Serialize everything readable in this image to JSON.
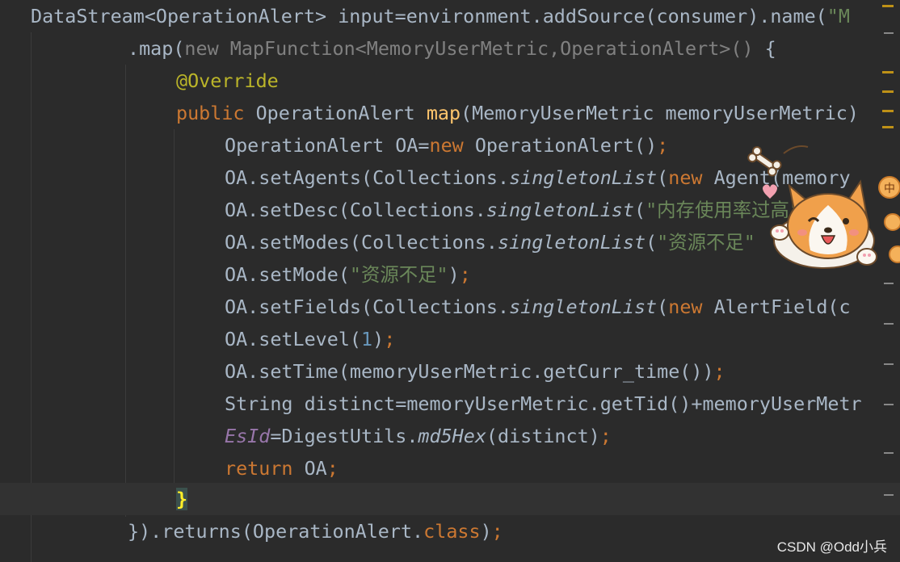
{
  "code": {
    "l1": {
      "a": "DataStream<OperationAlert> input=environment.addSource(consumer).name(",
      "b": "\"M"
    },
    "l2": {
      "a": ".map(",
      "b": "new ",
      "c": "MapFunction<MemoryUserMetric,OperationAlert>() ",
      "d": "{"
    },
    "l3": {
      "a": "@Override"
    },
    "l4": {
      "a": "public ",
      "b": "OperationAlert ",
      "c": "map",
      "d": "(MemoryUserMetric memoryUserMetric)"
    },
    "l5": {
      "a": "OperationAlert OA=",
      "b": "new ",
      "c": "OperationAlert()",
      "d": ";"
    },
    "l6": {
      "a": "OA.setAgents(Collections.",
      "b": "singletonList",
      "c": "(",
      "d": "new ",
      "e": "Agent(memory"
    },
    "l7": {
      "a": "OA.setDesc(Collections.",
      "b": "singletonList",
      "c": "(",
      "d": "\"内存使用率过高\"",
      "e": ")",
      "f": ";"
    },
    "l8": {
      "a": "OA.setModes(Collections.",
      "b": "singletonList",
      "c": "(",
      "d": "\"资源不足\""
    },
    "l9": {
      "a": "OA.setMode(",
      "b": "\"资源不足\"",
      "c": ")",
      "d": ";"
    },
    "l10": {
      "a": "OA.setFields(Collections.",
      "b": "singletonList",
      "c": "(",
      "d": "new ",
      "e": "AlertField(",
      "f": "c"
    },
    "l11": {
      "a": "OA.setLevel(",
      "b": "1",
      "c": ")",
      "d": ";"
    },
    "l12": {
      "a": "OA.setTime(memoryUserMetric.getCurr_time())",
      "b": ";"
    },
    "l13": {
      "a": "String distinct=memoryUserMetric.getTid()+memoryUserMetr"
    },
    "l14": {
      "a": "EsId",
      "b": "=DigestUtils.",
      "c": "md5Hex",
      "d": "(distinct)",
      "e": ";"
    },
    "l15": {
      "a": "return ",
      "b": "OA",
      "c": ";"
    },
    "l16": {
      "a": "}"
    },
    "l17": {
      "a": "}).returns(OperationAlert.",
      "b": "class",
      "c": ")",
      "d": ";"
    }
  },
  "colors": {
    "background": "#2b2b2b",
    "keyword": "#cc7832",
    "method_decl": "#ffc66d",
    "annotation": "#bbb529",
    "string": "#6a8759",
    "number": "#6897bb",
    "plain": "#a9b7c6",
    "static_field": "#9876aa",
    "brace_match": "#ffef28"
  },
  "sticker": {
    "icon": "corgi-dog-sticker-icon",
    "badge_text": "中"
  },
  "watermark": {
    "text": "CSDN @Odd小兵"
  }
}
